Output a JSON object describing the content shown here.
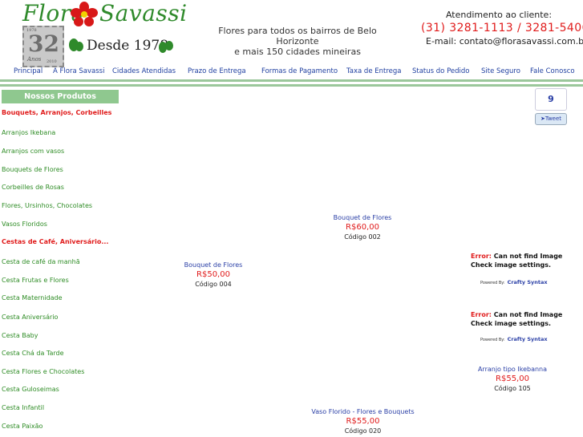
{
  "header": {
    "logo_left": "Flora",
    "logo_right": "Savassi",
    "stamp_years": "32",
    "stamp_label": "Anos",
    "stamp_from": "1978",
    "stamp_to": "2010",
    "since": "Desde 1978",
    "tagline_1": "Flores para todos os bairros de Belo Horizonte",
    "tagline_2": "e mais 150 cidades mineiras",
    "contact_title": "Atendimento ao cliente:",
    "phones": "(31) 3281-1113  / 3281-5406",
    "email": "E-mail: contato@florasavassi.com.br"
  },
  "nav": [
    "Principal",
    "A Flora Savassi",
    "Cidades Atendidas",
    "Prazo de Entrega",
    "Formas de Pagamento",
    "Taxa de Entrega",
    "Status do Pedido",
    "Site Seguro",
    "Fale Conosco"
  ],
  "sidebar": {
    "heading": "Nossos Produtos",
    "items": [
      {
        "label": "Bouquets, Arranjos, Corbeilles",
        "heading": true
      },
      {
        "label": "Arranjos Ikebana"
      },
      {
        "label": "Arranjos com vasos"
      },
      {
        "label": "Bouquets de Flores"
      },
      {
        "label": "Corbeilles de Rosas"
      },
      {
        "label": "Flores, Ursinhos, Chocolates"
      },
      {
        "label": "Vasos Floridos"
      },
      {
        "label": "Cestas de Café, Aniversário...",
        "heading": true
      },
      {
        "label": "Cesta de café da manhã"
      },
      {
        "label": "Cesta Frutas e Flores"
      },
      {
        "label": "Cesta Maternidade"
      },
      {
        "label": "Cesta Aniversário"
      },
      {
        "label": "Cesta Baby"
      },
      {
        "label": "Cesta Chá da Tarde"
      },
      {
        "label": "Cesta Flores e Chocolates"
      },
      {
        "label": "Cesta Guloseimas"
      },
      {
        "label": "Cesta Infantil"
      },
      {
        "label": "Cesta Paixão"
      }
    ]
  },
  "products": [
    {
      "name": "Bouquet de Flores",
      "price": "R$60,00",
      "code": "Código 002"
    },
    {
      "name": "Bouquet de Flores",
      "price": "R$50,00",
      "code": "Código 004"
    },
    {
      "name": "Arranjo tipo Ikebanna",
      "price": "R$55,00",
      "code": "Código 105"
    },
    {
      "name": "Vaso Florido - Flores e Bouquets",
      "price": "R$55,00",
      "code": "Código 020"
    }
  ],
  "errors": [
    {
      "label": "Error:",
      "msg1": "Can not find Image",
      "msg2": "Check image settings.",
      "powered": "Powered By:",
      "brand": "Crafty Syntax"
    },
    {
      "label": "Error:",
      "msg1": "Can not find Image",
      "msg2": "Check image settings.",
      "powered": "Powered By:",
      "brand": "Crafty Syntax"
    }
  ],
  "tweet": {
    "count": "9",
    "label": "Tweet"
  }
}
